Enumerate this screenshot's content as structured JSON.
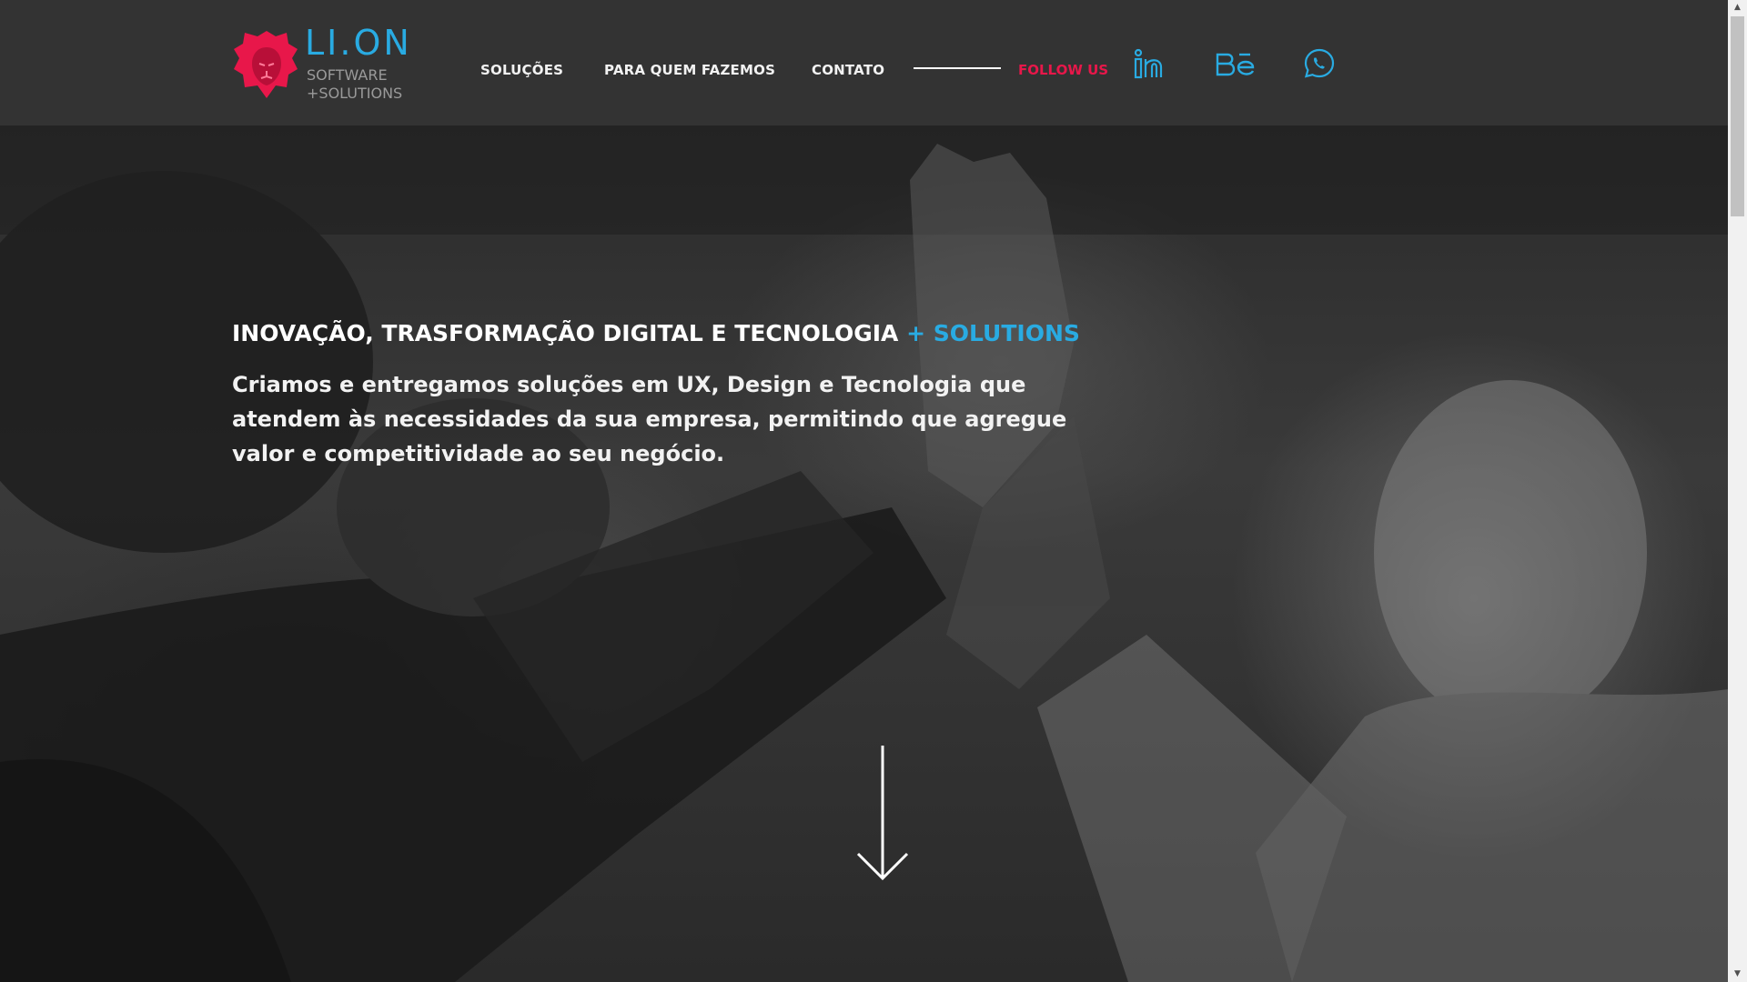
{
  "brand": {
    "name": "LI.ON",
    "sub1": "SOFTWARE",
    "sub2": "+SOLUTIONS",
    "accent_color": "#29abe2",
    "logo_color": "#e8174a"
  },
  "nav": {
    "items": [
      {
        "label": "SOLUÇÕES"
      },
      {
        "label": "PARA QUEM FAZEMOS"
      },
      {
        "label": "CONTATO"
      }
    ],
    "follow_label": "FOLLOW US",
    "social": [
      {
        "icon": "linkedin-icon"
      },
      {
        "icon": "behance-icon"
      },
      {
        "icon": "whatsapp-icon"
      }
    ]
  },
  "hero": {
    "title": "INOVAÇÃO, TRASFORMAÇÃO DIGITAL E TECNOLOGIA",
    "title_accent": "+ SOLUTIONS",
    "text": "Criamos e entregamos soluções em UX, Design e Tecnologia que atendem às necessidades da sua empresa, permitindo que agregue valor e competitividade ao seu negócio.",
    "scroll_icon": "arrow-down-icon"
  },
  "scrollbar": {
    "up_icon": "▲",
    "down_icon": "▼"
  },
  "colors": {
    "header_bg": "#333333",
    "follow": "#e8174a",
    "social": "#29abe2"
  }
}
